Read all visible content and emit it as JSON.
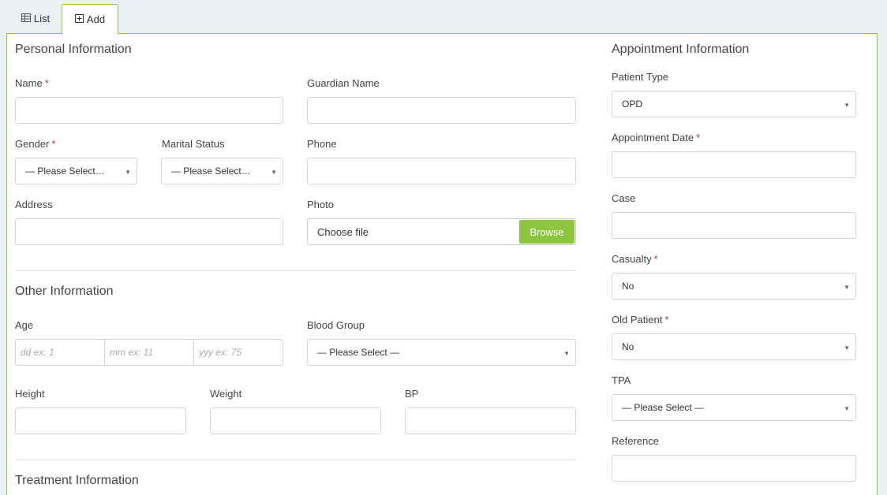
{
  "tabs": {
    "list_label": "List",
    "add_label": "Add"
  },
  "personal": {
    "title": "Personal Information",
    "name_label": "Name",
    "guardian_label": "Guardian Name",
    "gender_label": "Gender",
    "gender_value": "— Please Select…",
    "marital_label": "Marital Status",
    "marital_value": "— Please Select…",
    "phone_label": "Phone",
    "address_label": "Address",
    "photo_label": "Photo",
    "file_text": "Choose file",
    "browse_label": "Browse",
    "required_mark": "*"
  },
  "other": {
    "title": "Other Information",
    "age_label": "Age",
    "age_dd_placeholder": "dd ex: 1",
    "age_mm_placeholder": "mm ex: 11",
    "age_yy_placeholder": "yyy ex: 75",
    "blood_label": "Blood Group",
    "blood_value": "— Please Select —",
    "height_label": "Height",
    "weight_label": "Weight",
    "bp_label": "BP"
  },
  "treatment": {
    "title": "Treatment Information"
  },
  "appointment": {
    "title": "Appointment Information",
    "patient_type_label": "Patient Type",
    "patient_type_value": "OPD",
    "date_label": "Appointment Date",
    "case_label": "Case",
    "casualty_label": "Casualty",
    "casualty_value": "No",
    "old_patient_label": "Old Patient",
    "old_patient_value": "No",
    "tpa_label": "TPA",
    "tpa_value": "— Please Select —",
    "reference_label": "Reference"
  },
  "icons": {
    "list_icon": "table-icon",
    "add_icon": "plus-square-icon",
    "caret": "caret-down-icon"
  },
  "colors": {
    "accent": "#8cc63f",
    "required": "#c9302c"
  }
}
